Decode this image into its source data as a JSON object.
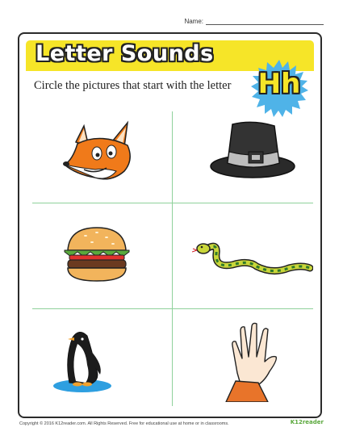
{
  "header": {
    "name_label": "Name:"
  },
  "banner": {
    "title": "Letter Sounds"
  },
  "instruction": "Circle the pictures that start with the letter",
  "letter_badge": "Hh",
  "pictures": [
    {
      "icon": "fox-icon"
    },
    {
      "icon": "pilgrim-hat-icon"
    },
    {
      "icon": "hamburger-icon"
    },
    {
      "icon": "snake-icon"
    },
    {
      "icon": "penguin-icon"
    },
    {
      "icon": "hand-icon"
    }
  ],
  "footer": {
    "copyright": "Copyright © 2016  K12reader.com. All Rights Reserved. Free for educational use at home or in classrooms.",
    "logo": "K12reader"
  },
  "colors": {
    "banner": "#f6e528",
    "grid_lines": "#8fd19b",
    "badge_burst": "#4fb3e8"
  }
}
